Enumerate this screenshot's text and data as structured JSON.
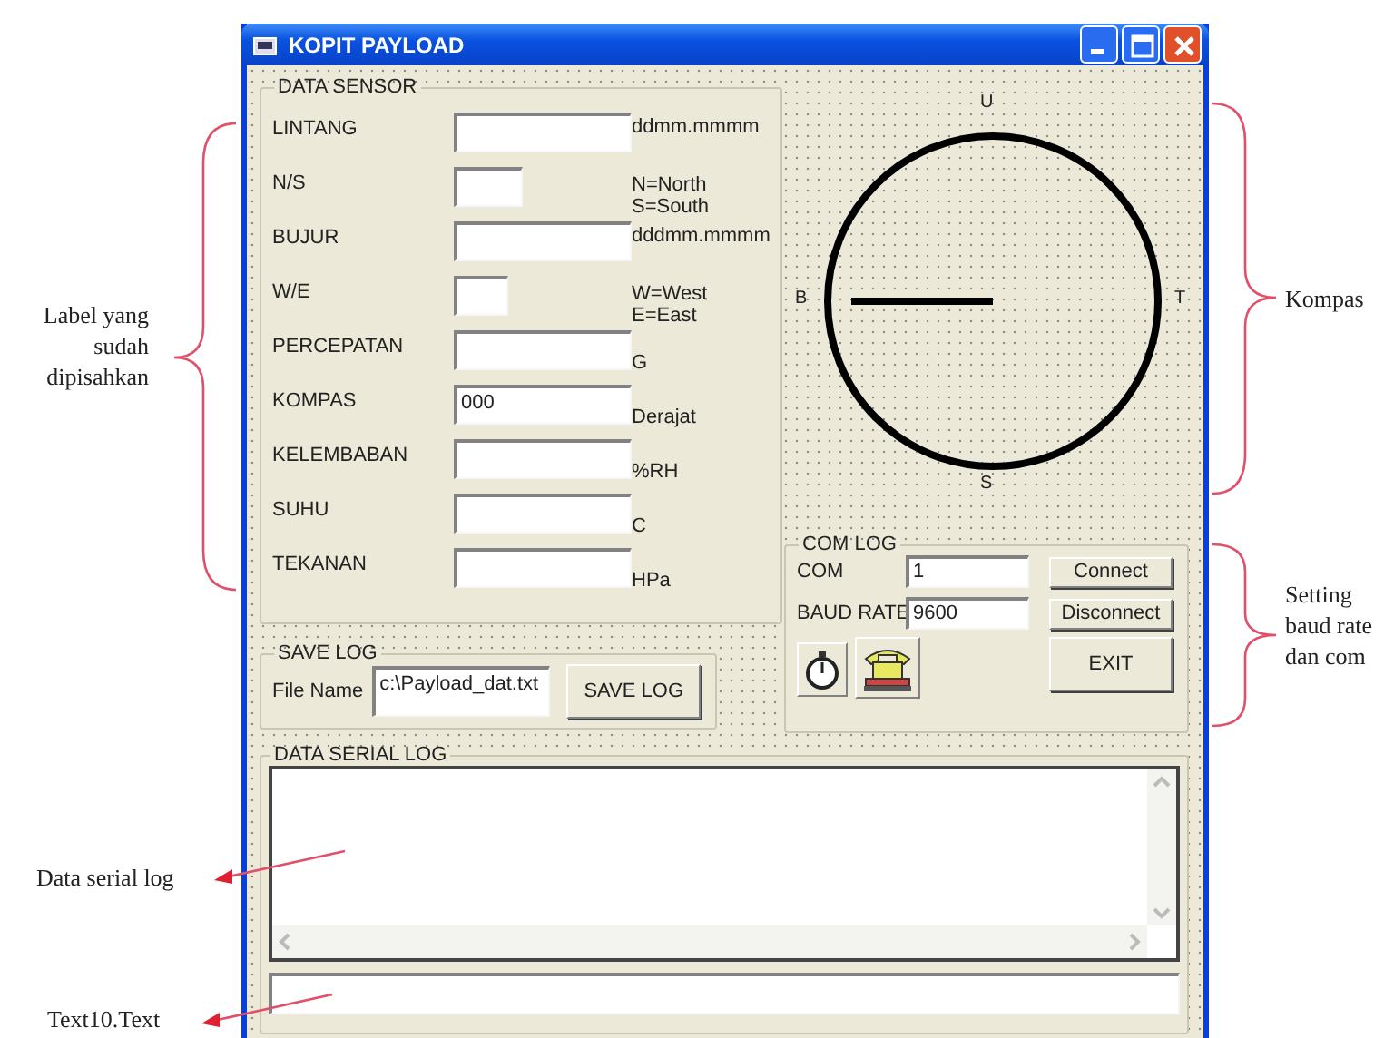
{
  "window": {
    "title": "KOPIT PAYLOAD"
  },
  "data_sensor": {
    "title": "DATA SENSOR",
    "rows": [
      {
        "label": "LINTANG",
        "kind": "long",
        "unit": [
          "ddmm.mmmm"
        ]
      },
      {
        "label": "N/S",
        "kind": "short",
        "unit": [
          "N=North",
          "S=South"
        ]
      },
      {
        "label": "BUJUR",
        "kind": "long",
        "unit": [
          "dddmm.mmmm"
        ]
      },
      {
        "label": "W/E",
        "kind": "tiny",
        "unit": [
          "W=West",
          "E=East"
        ]
      },
      {
        "label": "PERCEPATAN",
        "kind": "long",
        "unit": [
          "G"
        ]
      },
      {
        "label": "KOMPAS",
        "kind": "long",
        "value": "000",
        "unit": [
          "Derajat"
        ]
      },
      {
        "label": "KELEMBABAN",
        "kind": "long",
        "unit": [
          "%RH"
        ]
      },
      {
        "label": "SUHU",
        "kind": "long",
        "unit": [
          "C"
        ]
      },
      {
        "label": "TEKANAN",
        "kind": "long",
        "unit": [
          "HPa"
        ]
      }
    ]
  },
  "compass": {
    "north": "U",
    "west": "B",
    "east": "T",
    "south": "S"
  },
  "save_log": {
    "title": "SAVE LOG",
    "label": "File Name",
    "value": "c:\\Payload_dat.txt",
    "button": "SAVE LOG"
  },
  "com_log": {
    "title": "COM LOG",
    "com": {
      "label": "COM",
      "value": "1"
    },
    "baud": {
      "label": "BAUD RATE",
      "value": "9600"
    },
    "buttons": [
      "Connect",
      "Disconnect",
      "EXIT"
    ]
  },
  "serial_log": {
    "title": "DATA SERIAL LOG"
  },
  "annotations": [
    {
      "kind": "brace-left",
      "text": "Label yang sudah dipisahkan"
    },
    {
      "kind": "arrow-left",
      "text": "Data serial log"
    },
    {
      "kind": "arrow-left-low",
      "text": "Text10.Text"
    },
    {
      "kind": "brace-right",
      "text": "Kompas"
    },
    {
      "kind": "brace-right-low",
      "text": "Setting baud rate dan com"
    }
  ]
}
